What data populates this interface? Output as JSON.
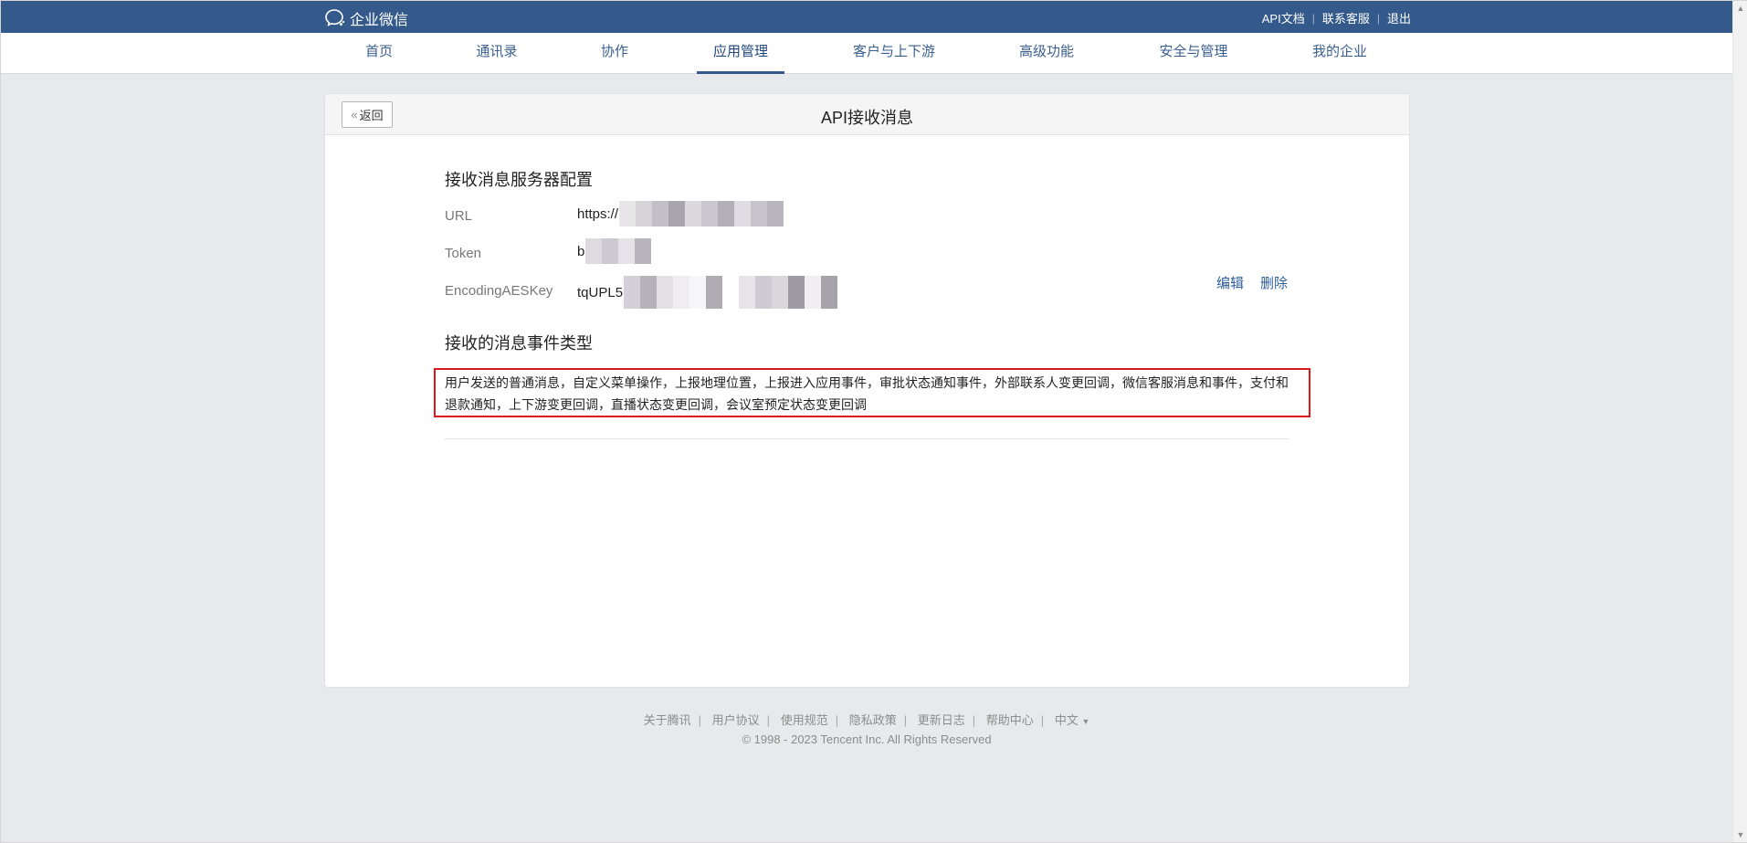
{
  "brand": {
    "name": "企业微信"
  },
  "topLinks": [
    "API文档",
    "联系客服",
    "退出"
  ],
  "nav": {
    "items": [
      "首页",
      "通讯录",
      "协作",
      "应用管理",
      "客户与上下游",
      "高级功能",
      "安全与管理",
      "我的企业"
    ],
    "active": "应用管理"
  },
  "page": {
    "back_label": "返回",
    "title": "API接收消息"
  },
  "server_config": {
    "title": "接收消息服务器配置",
    "url_label": "URL",
    "url_value": "https://",
    "token_label": "Token",
    "token_value": "b",
    "aes_label": "EncodingAESKey",
    "aes_value": "tqUPL5",
    "edit_label": "编辑",
    "delete_label": "删除"
  },
  "events": {
    "title": "接收的消息事件类型",
    "text": "用户发送的普通消息，自定义菜单操作，上报地理位置，上报进入应用事件，审批状态通知事件，外部联系人变更回调，微信客服消息和事件，支付和退款通知，上下游变更回调，直播状态变更回调，会议室预定状态变更回调"
  },
  "footer": {
    "links": [
      "关于腾讯",
      "用户协议",
      "使用规范",
      "隐私政策",
      "更新日志",
      "帮助中心",
      "中文"
    ],
    "copyright": "© 1998 - 2023 Tencent Inc. All Rights Reserved"
  }
}
